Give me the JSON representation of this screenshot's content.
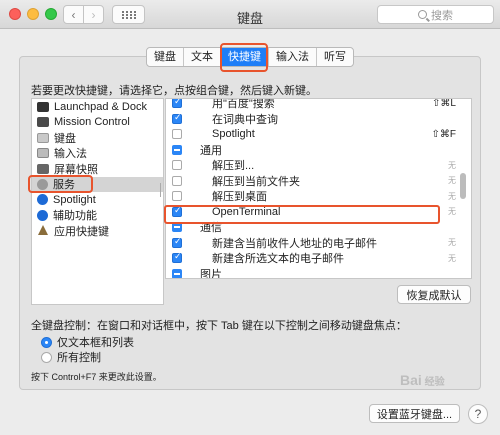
{
  "window": {
    "title": "键盘"
  },
  "search": {
    "placeholder": "搜索"
  },
  "tabs": [
    {
      "label": "键盘",
      "active": false
    },
    {
      "label": "文本",
      "active": false
    },
    {
      "label": "快捷键",
      "active": true
    },
    {
      "label": "输入法",
      "active": false
    },
    {
      "label": "听写",
      "active": false
    }
  ],
  "instruction": "若要更改快捷键，请选择它，点按组合键，然后键入新键。",
  "categories": [
    {
      "label": "Launchpad & Dock",
      "icon": "launchpad-icon"
    },
    {
      "label": "Mission Control",
      "icon": "mission-control-icon"
    },
    {
      "label": "键盘",
      "icon": "keyboard-icon"
    },
    {
      "label": "输入法",
      "icon": "input-method-icon"
    },
    {
      "label": "屏幕快照",
      "icon": "screenshot-icon"
    },
    {
      "label": "服务",
      "icon": "services-icon",
      "selected": true
    },
    {
      "label": "Spotlight",
      "icon": "spotlight-icon"
    },
    {
      "label": "辅助功能",
      "icon": "accessibility-icon"
    },
    {
      "label": "应用快捷键",
      "icon": "app-shortcuts-icon"
    }
  ],
  "shortcuts": [
    {
      "type": "item",
      "checked": true,
      "label": "用\"百度\"搜索",
      "key": "⇧⌘L"
    },
    {
      "type": "item",
      "checked": true,
      "label": "在词典中查询",
      "key": ""
    },
    {
      "type": "item",
      "checked": false,
      "label": "Spotlight",
      "key": "⇧⌘F"
    },
    {
      "type": "group",
      "label": "通用"
    },
    {
      "type": "item",
      "checked": false,
      "label": "解压到...",
      "key": "无"
    },
    {
      "type": "item",
      "checked": false,
      "label": "解压到当前文件夹",
      "key": "无"
    },
    {
      "type": "item",
      "checked": false,
      "label": "解压到桌面",
      "key": "无"
    },
    {
      "type": "item",
      "checked": true,
      "label": "OpenTerminal",
      "key": "无"
    },
    {
      "type": "group",
      "label": "通信"
    },
    {
      "type": "item",
      "checked": true,
      "label": "新建含当前收件人地址的电子邮件",
      "key": "无"
    },
    {
      "type": "item",
      "checked": true,
      "label": "新建含所选文本的电子邮件",
      "key": "无"
    },
    {
      "type": "group",
      "label": "图片"
    }
  ],
  "restore_label": "恢复成默认",
  "keyboard_control": {
    "label": "全键盘控制：在窗口和对话框中，按下 Tab 键在以下控制之间移动键盘焦点：",
    "options": [
      {
        "label": "仅文本框和列表",
        "selected": true
      },
      {
        "label": "所有控制",
        "selected": false
      }
    ]
  },
  "note": "按下 Control+F7 来更改此设置。",
  "bluetooth_label": "设置蓝牙键盘...",
  "help_label": "?",
  "watermark": "Bai 经验"
}
